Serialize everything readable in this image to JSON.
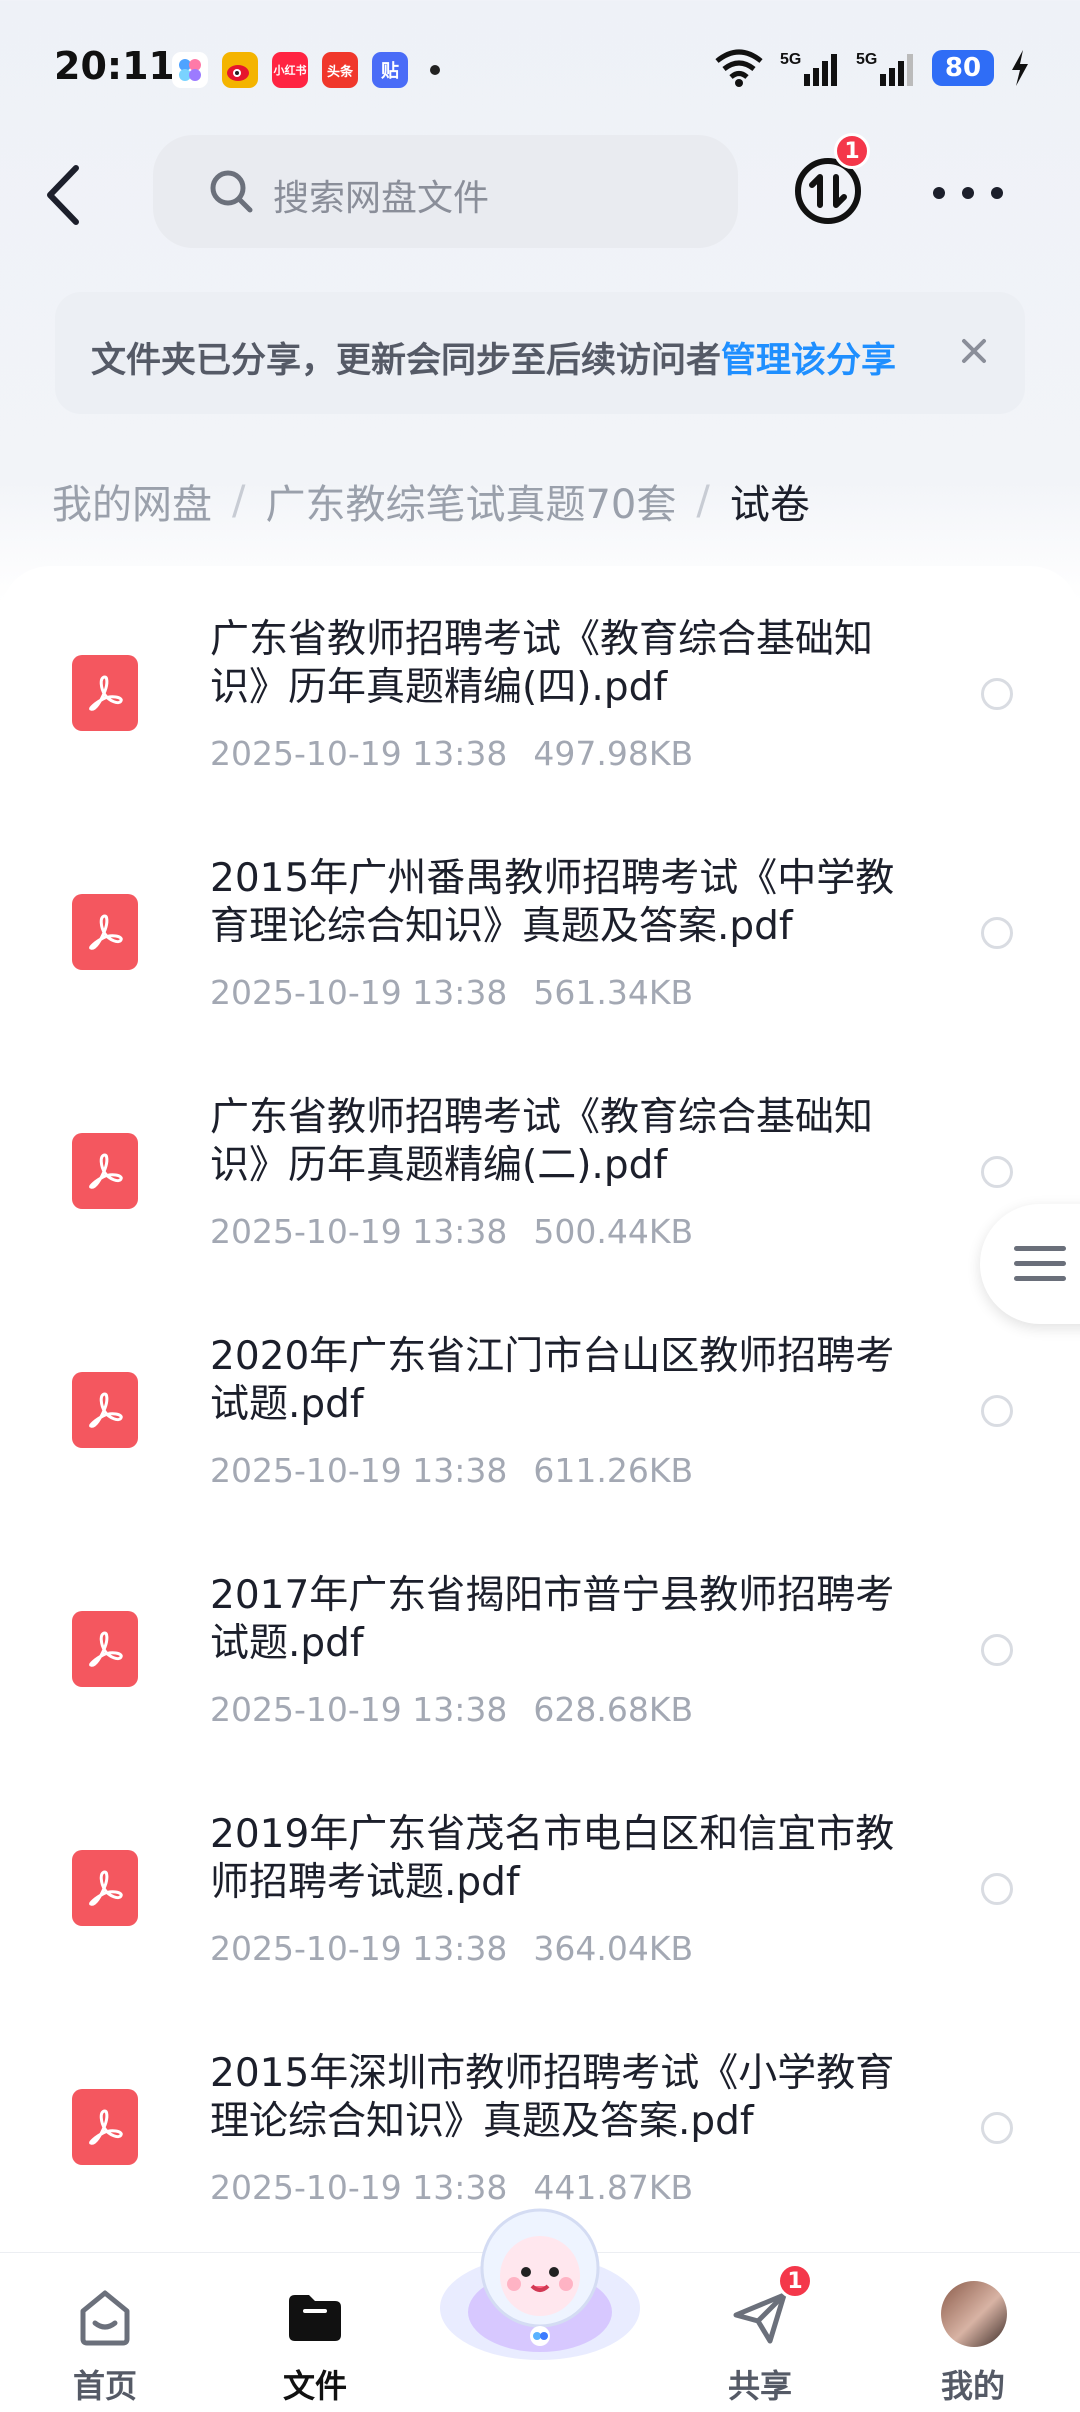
{
  "status_bar": {
    "time": "20:11",
    "app_icons": [
      {
        "name": "clover-icon",
        "color": "#f2f3f7",
        "text": ""
      },
      {
        "name": "weibo-icon",
        "color": "#f4b400",
        "text": ""
      },
      {
        "name": "xiaohongshu-icon",
        "color": "#ff2442",
        "text": "小红书"
      },
      {
        "name": "toutiao-icon",
        "color": "#f0372b",
        "text": "头条"
      },
      {
        "name": "tieba-icon",
        "color": "#4a6cf7",
        "text": "贴"
      }
    ],
    "network": "5G",
    "battery": "80"
  },
  "header": {
    "search_placeholder": "搜索网盘文件",
    "transfer_badge": "1"
  },
  "notice": {
    "text": "文件夹已分享，更新会同步至后续访问者",
    "link": "管理该分享"
  },
  "breadcrumb": [
    "我的网盘",
    "广东教综笔试真题70套",
    "试卷"
  ],
  "files": [
    {
      "name": "广东省教师招聘考试《教育综合基础知识》历年真题精编(四).pdf",
      "date": "2025-10-19  13:38",
      "size": "497.98KB"
    },
    {
      "name": "2015年广州番禺教师招聘考试《中学教育理论综合知识》真题及答案.pdf",
      "date": "2025-10-19  13:38",
      "size": "561.34KB"
    },
    {
      "name": "广东省教师招聘考试《教育综合基础知识》历年真题精编(二).pdf",
      "date": "2025-10-19  13:38",
      "size": "500.44KB"
    },
    {
      "name": "2020年广东省江门市台山区教师招聘考试题.pdf",
      "date": "2025-10-19  13:38",
      "size": "611.26KB"
    },
    {
      "name": "2017年广东省揭阳市普宁县教师招聘考试题.pdf",
      "date": "2025-10-19  13:38",
      "size": "628.68KB"
    },
    {
      "name": "2019年广东省茂名市电白区和信宜市教师招聘考试题.pdf",
      "date": "2025-10-19  13:38",
      "size": "364.04KB"
    },
    {
      "name": "2015年深圳市教师招聘考试《小学教育理论综合知识》真题及答案.pdf",
      "date": "2025-10-19  13:38",
      "size": "441.87KB"
    }
  ],
  "bottom_nav": {
    "home": "首页",
    "files": "文件",
    "share": "共享",
    "share_badge": "1",
    "mine": "我的"
  },
  "colors": {
    "accent": "#1f8fff",
    "pdf": "#f4575f",
    "badge": "#f4374a"
  }
}
